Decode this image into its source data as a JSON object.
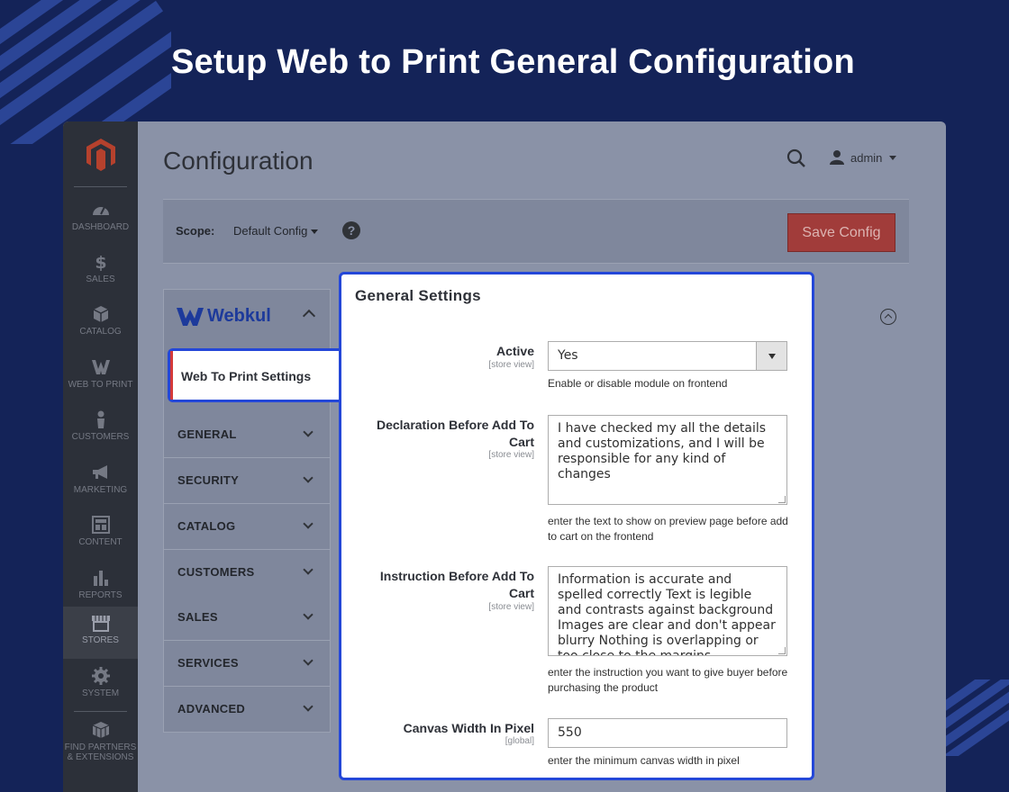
{
  "banner": {
    "title": "Setup Web to Print General Configuration"
  },
  "sidebar": {
    "items": [
      {
        "label": "DASHBOARD",
        "icon": "dashboard-icon"
      },
      {
        "label": "SALES",
        "icon": "dollar-icon"
      },
      {
        "label": "CATALOG",
        "icon": "box-icon"
      },
      {
        "label": "WEB TO PRINT",
        "icon": "webkul-w-icon"
      },
      {
        "label": "CUSTOMERS",
        "icon": "person-icon"
      },
      {
        "label": "MARKETING",
        "icon": "megaphone-icon"
      },
      {
        "label": "CONTENT",
        "icon": "layout-icon"
      },
      {
        "label": "REPORTS",
        "icon": "bar-chart-icon"
      },
      {
        "label": "STORES",
        "icon": "store-icon"
      },
      {
        "label": "SYSTEM",
        "icon": "gear-icon"
      },
      {
        "label": "FIND PARTNERS & EXTENSIONS",
        "icon": "boxes-icon"
      }
    ]
  },
  "header": {
    "title": "Configuration",
    "user": "admin"
  },
  "scope": {
    "label": "Scope:",
    "value": "Default Config",
    "save_label": "Save Config"
  },
  "nav": {
    "vendor": "Webkul",
    "active_tab": "Web To Print Settings",
    "sections": [
      "GENERAL",
      "SECURITY",
      "CATALOG",
      "CUSTOMERS",
      "SALES",
      "SERVICES",
      "ADVANCED"
    ]
  },
  "panel": {
    "title": "General Settings",
    "fields": [
      {
        "label": "Active",
        "scope": "[store view]",
        "value": "Yes",
        "note": "Enable or disable module on frontend"
      },
      {
        "label": "Declaration Before Add To Cart",
        "scope": "[store view]",
        "value": "I have checked my all the details and customizations, and I will be responsible for any kind of changes",
        "note": "enter the text to show on preview page before add to cart on the frontend"
      },
      {
        "label": "Instruction Before Add To Cart",
        "scope": "[store view]",
        "value": "Information is accurate and spelled correctly Text is legible and contrasts against background Images are clear and don't appear blurry Nothing is overlapping or too close to the margins",
        "note": "enter the instruction you want to give buyer before purchasing the product"
      },
      {
        "label": "Canvas Width In Pixel",
        "scope": "[global]",
        "value": "550",
        "note": "enter the minimum canvas width in pixel"
      }
    ]
  },
  "colors": {
    "background": "#142358",
    "highlight": "#2447d8",
    "save": "#a13c3a",
    "webkul": "#1d3a9b"
  }
}
